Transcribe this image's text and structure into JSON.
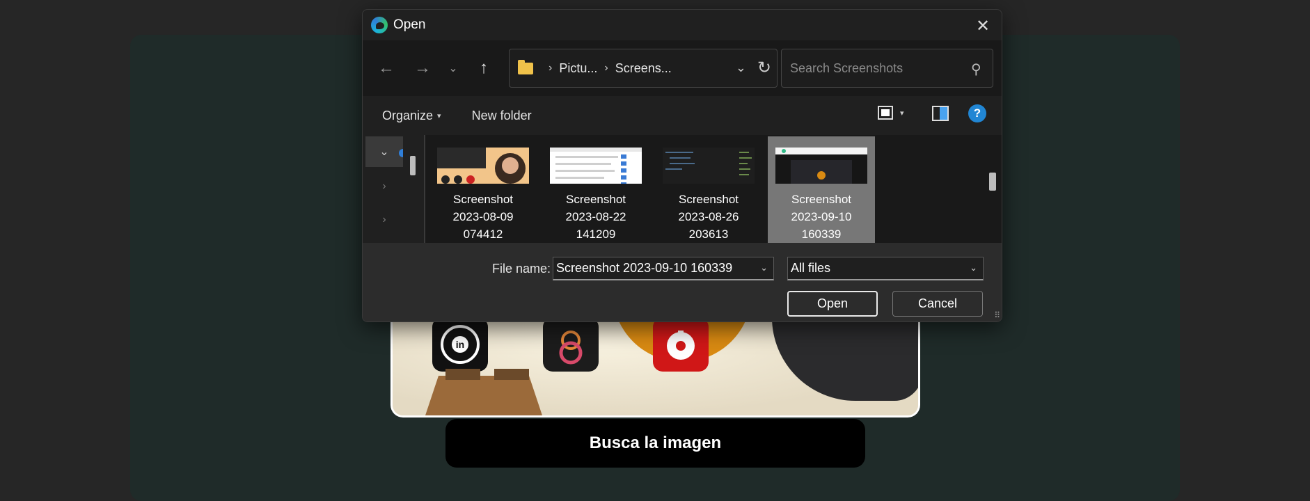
{
  "page": {
    "action_button_label": "Busca la imagen"
  },
  "dialog": {
    "title": "Open",
    "close_glyph": "✕",
    "nav": {
      "back_glyph": "←",
      "forward_glyph": "→",
      "recent_glyph": "⌄",
      "up_glyph": "↑"
    },
    "address": {
      "crumb_1": "Pictu...",
      "crumb_2": "Screens...",
      "sep": "›",
      "dropdown_glyph": "⌄",
      "refresh_glyph": "↻"
    },
    "search": {
      "placeholder": "Search Screenshots",
      "icon_glyph": "⚲"
    },
    "commands": {
      "organize": "Organize",
      "new_folder": "New folder",
      "help_glyph": "?",
      "caret": "▾"
    },
    "tree": {
      "expanded_glyph": "⌄",
      "collapsed_glyph": "›"
    },
    "files": [
      {
        "name": "Screenshot\n2023-08-09\n074412",
        "selected": false
      },
      {
        "name": "Screenshot\n2023-08-22\n141209",
        "selected": false
      },
      {
        "name": "Screenshot\n2023-08-26\n203613",
        "selected": false
      },
      {
        "name": "Screenshot\n2023-09-10\n160339",
        "selected": true
      }
    ],
    "footer": {
      "file_name_label": "File name:",
      "file_name_value": "Screenshot 2023-09-10 160339",
      "file_type": "All files",
      "dropdown_glyph": "⌄",
      "open_label": "Open",
      "cancel_label": "Cancel",
      "grip_glyph": "⠿"
    }
  },
  "colors": {
    "accent": "#2186d4",
    "folder": "#f0c24a",
    "selection": "#777777"
  }
}
